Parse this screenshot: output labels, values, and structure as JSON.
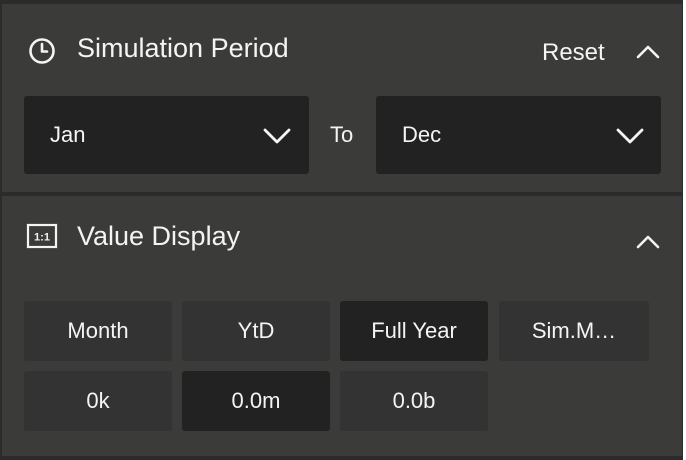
{
  "simulation_period": {
    "title": "Simulation Period",
    "icon": "clock-icon",
    "reset_label": "Reset",
    "from_value": "Jan",
    "to_label": "To",
    "to_value": "Dec",
    "expanded": true
  },
  "value_display": {
    "title": "Value Display",
    "icon": "ratio-1-1-icon",
    "icon_text": "1:1",
    "expanded": true,
    "period_options": [
      {
        "label": "Month",
        "selected": false
      },
      {
        "label": "YtD",
        "selected": false
      },
      {
        "label": "Full Year",
        "selected": true
      },
      {
        "label": "Sim.M…",
        "selected": false
      }
    ],
    "scale_options": [
      {
        "label": "0k",
        "selected": false
      },
      {
        "label": "0.0m",
        "selected": true
      },
      {
        "label": "0.0b",
        "selected": false
      }
    ]
  },
  "colors": {
    "panel_bg": "#3b3b3a",
    "page_bg": "#2b2b2b",
    "field_bg": "#222222",
    "tile_bg": "#333333",
    "text": "#f4f4f4"
  }
}
